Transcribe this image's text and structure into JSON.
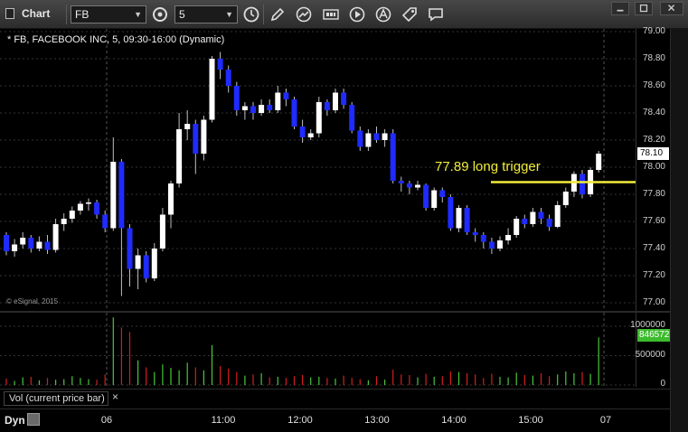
{
  "toolbar": {
    "title": "Chart",
    "symbol": "FB",
    "interval": "5"
  },
  "chart": {
    "symbol_label": "* FB, FACEBOOK INC, 5, 09:30-16:00 (Dynamic)",
    "copyright": "© eSignal, 2015",
    "annotation": "77.89 long trigger",
    "last_price": "78.10",
    "last_volume": "846572",
    "price_ticks": [
      "79.00",
      "78.80",
      "78.60",
      "78.40",
      "78.20",
      "78.00",
      "77.80",
      "77.60",
      "77.40",
      "77.20",
      "77.00"
    ],
    "volume_ticks": [
      "1000000",
      "500000",
      "0"
    ],
    "time_ticks": [
      "06",
      "11:00",
      "12:00",
      "13:00",
      "14:00",
      "15:00",
      "07"
    ],
    "volume_study_label": "Vol (current price bar)",
    "dyn_label": "Dyn",
    "colors": {
      "up": "#ffffff",
      "down": "#1f2bff",
      "trigger": "#f1ec3b",
      "vol_up": "#49c63a",
      "vol_down": "#d11f1f"
    }
  },
  "chart_data": {
    "type": "candlestick",
    "title": "* FB, FACEBOOK INC, 5, 09:30-16:00 (Dynamic)",
    "ylim": [
      77.0,
      79.0
    ],
    "yticks": [
      79.0,
      78.8,
      78.6,
      78.4,
      78.2,
      78.0,
      77.8,
      77.6,
      77.4,
      77.2,
      77.0
    ],
    "xticks": [
      "06",
      "11:00",
      "12:00",
      "13:00",
      "14:00",
      "15:00",
      "07"
    ],
    "trigger_level": 77.89,
    "trigger_label": "77.89 long trigger",
    "last_price": 78.1,
    "candles": [
      [
        77.5,
        77.38,
        77.52,
        77.35
      ],
      [
        77.38,
        77.43,
        77.47,
        77.34
      ],
      [
        77.43,
        77.48,
        77.52,
        77.4
      ],
      [
        77.48,
        77.4,
        77.5,
        77.37
      ],
      [
        77.4,
        77.45,
        77.49,
        77.38
      ],
      [
        77.45,
        77.39,
        77.5,
        77.36
      ],
      [
        77.39,
        77.58,
        77.62,
        77.37
      ],
      [
        77.58,
        77.62,
        77.66,
        77.53
      ],
      [
        77.62,
        77.68,
        77.71,
        77.59
      ],
      [
        77.68,
        77.73,
        77.75,
        77.65
      ],
      [
        77.73,
        77.74,
        77.77,
        77.68
      ],
      [
        77.74,
        77.65,
        77.76,
        77.62
      ],
      [
        77.65,
        77.55,
        77.68,
        77.52
      ],
      [
        77.55,
        78.04,
        78.22,
        77.53
      ],
      [
        78.04,
        77.55,
        78.06,
        77.05
      ],
      [
        77.55,
        77.25,
        77.58,
        77.12
      ],
      [
        77.25,
        77.35,
        77.4,
        77.1
      ],
      [
        77.35,
        77.18,
        77.38,
        77.15
      ],
      [
        77.18,
        77.4,
        77.44,
        77.16
      ],
      [
        77.4,
        77.65,
        77.7,
        77.38
      ],
      [
        77.65,
        77.88,
        77.9,
        77.55
      ],
      [
        77.88,
        78.28,
        78.4,
        77.85
      ],
      [
        78.28,
        78.32,
        78.42,
        78.2
      ],
      [
        78.32,
        78.1,
        78.35,
        77.95
      ],
      [
        78.1,
        78.35,
        78.38,
        78.05
      ],
      [
        78.35,
        78.8,
        78.82,
        78.33
      ],
      [
        78.8,
        78.72,
        78.85,
        78.65
      ],
      [
        78.72,
        78.6,
        78.75,
        78.55
      ],
      [
        78.6,
        78.42,
        78.63,
        78.38
      ],
      [
        78.42,
        78.45,
        78.48,
        78.35
      ],
      [
        78.45,
        78.4,
        78.48,
        78.35
      ],
      [
        78.4,
        78.46,
        78.5,
        78.38
      ],
      [
        78.46,
        78.42,
        78.5,
        78.4
      ],
      [
        78.42,
        78.55,
        78.6,
        78.4
      ],
      [
        78.55,
        78.5,
        78.58,
        78.45
      ],
      [
        78.5,
        78.3,
        78.52,
        78.28
      ],
      [
        78.3,
        78.22,
        78.35,
        78.18
      ],
      [
        78.22,
        78.25,
        78.28,
        78.2
      ],
      [
        78.25,
        78.48,
        78.52,
        78.22
      ],
      [
        78.48,
        78.42,
        78.5,
        78.38
      ],
      [
        78.42,
        78.55,
        78.58,
        78.4
      ],
      [
        78.55,
        78.46,
        78.58,
        78.43
      ],
      [
        78.46,
        78.27,
        78.48,
        78.25
      ],
      [
        78.27,
        78.15,
        78.3,
        78.12
      ],
      [
        78.15,
        78.25,
        78.28,
        78.12
      ],
      [
        78.25,
        78.2,
        78.3,
        78.18
      ],
      [
        78.2,
        78.25,
        78.28,
        78.15
      ],
      [
        78.25,
        77.9,
        78.28,
        77.88
      ],
      [
        77.9,
        77.88,
        77.93,
        77.82
      ],
      [
        77.88,
        77.85,
        77.9,
        77.8
      ],
      [
        77.85,
        77.87,
        77.9,
        77.83
      ],
      [
        77.87,
        77.7,
        77.88,
        77.68
      ],
      [
        77.7,
        77.83,
        77.85,
        77.68
      ],
      [
        77.83,
        77.78,
        77.85,
        77.74
      ],
      [
        77.78,
        77.55,
        77.8,
        77.53
      ],
      [
        77.55,
        77.7,
        77.72,
        77.52
      ],
      [
        77.7,
        77.52,
        77.72,
        77.5
      ],
      [
        77.52,
        77.5,
        77.55,
        77.45
      ],
      [
        77.5,
        77.45,
        77.52,
        77.4
      ],
      [
        77.45,
        77.4,
        77.48,
        77.36
      ],
      [
        77.4,
        77.46,
        77.49,
        77.38
      ],
      [
        77.46,
        77.5,
        77.55,
        77.43
      ],
      [
        77.5,
        77.62,
        77.64,
        77.48
      ],
      [
        77.62,
        77.58,
        77.65,
        77.55
      ],
      [
        77.58,
        77.67,
        77.7,
        77.56
      ],
      [
        77.67,
        77.62,
        77.7,
        77.58
      ],
      [
        77.62,
        77.56,
        77.65,
        77.53
      ],
      [
        77.56,
        77.72,
        77.75,
        77.55
      ],
      [
        77.72,
        77.82,
        77.85,
        77.7
      ],
      [
        77.82,
        77.95,
        77.97,
        77.78
      ],
      [
        77.95,
        77.8,
        77.98,
        77.77
      ],
      [
        77.8,
        77.98,
        78.0,
        77.78
      ],
      [
        77.98,
        78.1,
        78.12,
        77.96
      ]
    ],
    "volume": [
      110000,
      70000,
      130000,
      140000,
      80000,
      120000,
      90000,
      100000,
      150000,
      120000,
      100000,
      90000,
      180000,
      1150000,
      980000,
      900000,
      420000,
      300000,
      220000,
      350000,
      290000,
      250000,
      380000,
      300000,
      250000,
      680000,
      320000,
      280000,
      220000,
      160000,
      180000,
      200000,
      130000,
      140000,
      120000,
      150000,
      170000,
      130000,
      140000,
      120000,
      110000,
      160000,
      120000,
      100000,
      80000,
      150000,
      90000,
      260000,
      180000,
      170000,
      130000,
      190000,
      140000,
      150000,
      230000,
      220000,
      200000,
      180000,
      120000,
      190000,
      140000,
      130000,
      210000,
      170000,
      160000,
      200000,
      150000,
      180000,
      230000,
      200000,
      220000,
      190000,
      810000
    ],
    "volume_ylim": [
      0,
      1200000
    ]
  }
}
